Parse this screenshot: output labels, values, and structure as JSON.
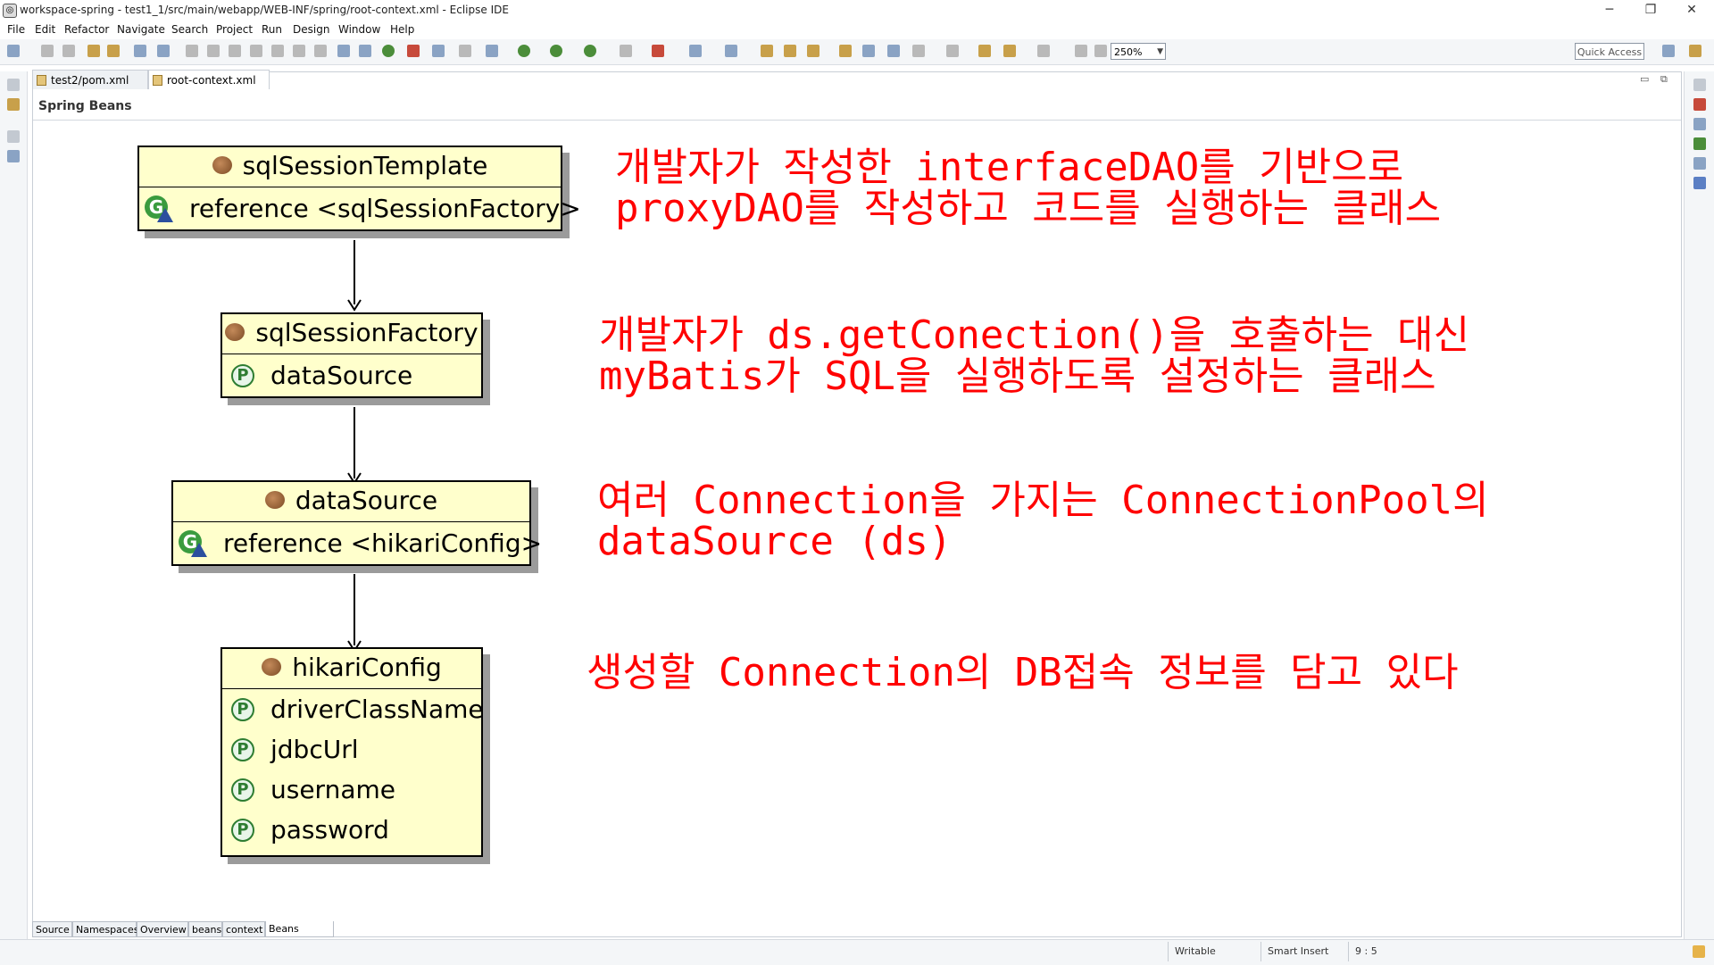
{
  "window": {
    "title": "workspace-spring - test1_1/src/main/webapp/WEB-INF/spring/root-context.xml - Eclipse IDE",
    "minimize": "─",
    "restore": "❐",
    "close": "✕"
  },
  "menu": [
    "File",
    "Edit",
    "Refactor",
    "Navigate",
    "Search",
    "Project",
    "Run",
    "Design",
    "Window",
    "Help"
  ],
  "toolbar": {
    "zoom_value": "250%",
    "quick_access": "Quick Access"
  },
  "editor_tabs": [
    {
      "label": "test2/pom.xml"
    },
    {
      "label": "root-context.xml",
      "close": "✕"
    }
  ],
  "editor": {
    "header": "Spring Beans"
  },
  "beans": [
    {
      "name": "sqlSessionTemplate",
      "rows": [
        {
          "type": "reference",
          "text": "reference <sqlSessionFactory>"
        }
      ]
    },
    {
      "name": "sqlSessionFactory",
      "rows": [
        {
          "type": "property",
          "text": "dataSource"
        }
      ]
    },
    {
      "name": "dataSource",
      "rows": [
        {
          "type": "reference",
          "text": "reference <hikariConfig>"
        }
      ]
    },
    {
      "name": "hikariConfig",
      "rows": [
        {
          "type": "property",
          "text": "driverClassName"
        },
        {
          "type": "property",
          "text": "jdbcUrl"
        },
        {
          "type": "property",
          "text": "username"
        },
        {
          "type": "property",
          "text": "password"
        }
      ]
    }
  ],
  "notes": [
    [
      "개발자가 작성한 interfaceDAO를 기반으로",
      "proxyDAO를 작성하고 코드를 실행하는 클래스"
    ],
    [
      "개발자가 ds.getConection()을 호출하는 대신",
      "myBatis가 SQL을 실행하도록 설정하는 클래스"
    ],
    [
      "여러 Connection을 가지는 ConnectionPool의",
      "dataSource (ds)"
    ],
    [
      "생성할 Connection의 DB접속 정보를 담고 있다"
    ]
  ],
  "bottom_tabs": [
    "Source",
    "Namespaces",
    "Overview",
    "beans",
    "context",
    "Beans Graph"
  ],
  "status": {
    "writable": "Writable",
    "insert_mode": "Smart Insert",
    "position": "9 : 5"
  },
  "colors": {
    "bean_fill": "#ffffcc",
    "note_text": "#ff0000"
  }
}
